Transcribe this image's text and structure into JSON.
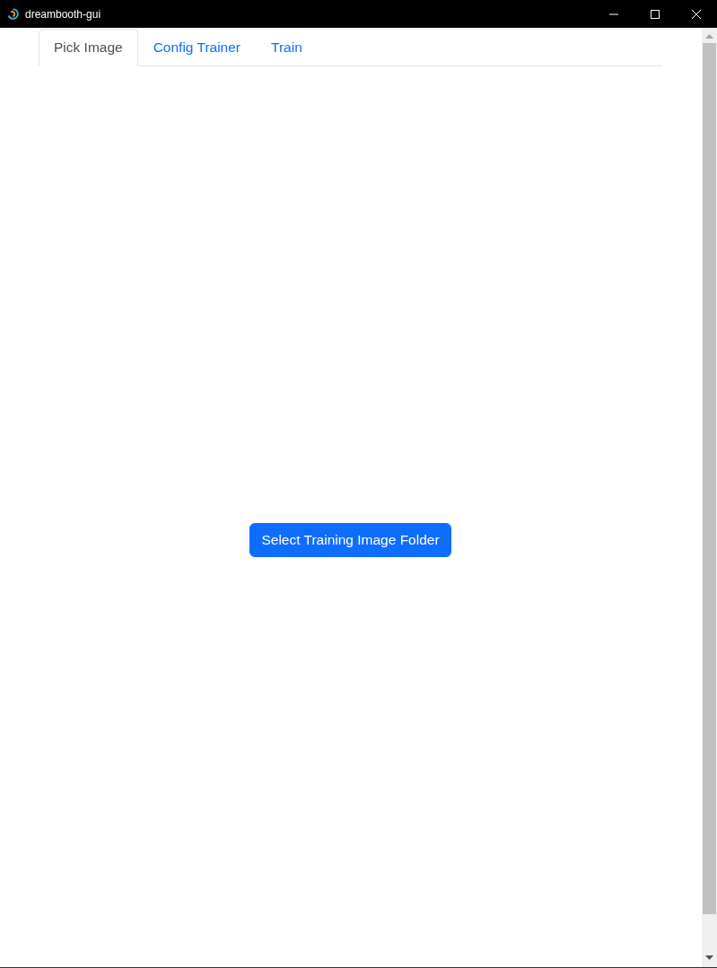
{
  "window": {
    "title": "dreambooth-gui"
  },
  "tabs": [
    {
      "label": "Pick Image",
      "selected": true
    },
    {
      "label": "Config Trainer",
      "selected": false
    },
    {
      "label": "Train",
      "selected": false
    }
  ],
  "panel": {
    "button": "Select Training Image Folder"
  }
}
